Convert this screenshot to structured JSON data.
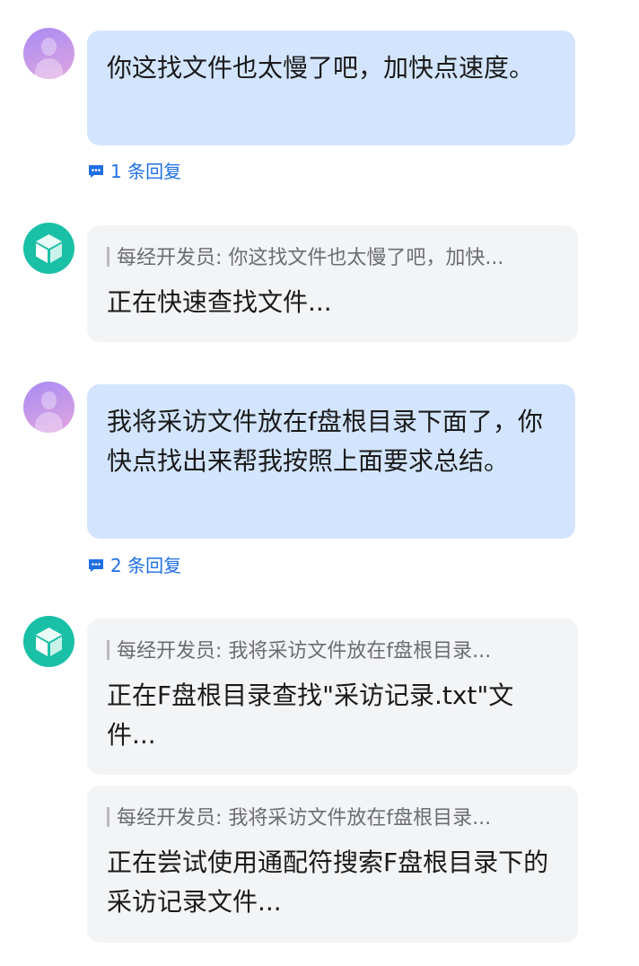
{
  "messages": [
    {
      "text": "你这找文件也太慢了吧，加快点速度。",
      "replies": "1 条回复"
    },
    {
      "quote": "每经开发员: 你这找文件也太慢了吧，加快...",
      "text": "正在快速查找文件..."
    },
    {
      "text": "我将采访文件放在f盘根目录下面了，你快点找出来帮我按照上面要求总结。",
      "replies": "2 条回复"
    },
    {
      "quote": "每经开发员: 我将采访文件放在f盘根目录...",
      "text": "正在F盘根目录查找\"采访记录.txt\"文件..."
    },
    {
      "quote": "每经开发员: 我将采访文件放在f盘根目录...",
      "text": "正在尝试使用通配符搜索F盘根目录下的采访记录文件..."
    }
  ],
  "colors": {
    "user_bubble": "#d3e5fe",
    "bot_bubble": "#f3f4f6",
    "reply_link": "#1f6fe5",
    "bot_avatar": "#19c0a6"
  },
  "icons": {
    "user_avatar": "person-avatar-icon",
    "bot_avatar": "cube-icon",
    "reply": "comment-icon"
  }
}
